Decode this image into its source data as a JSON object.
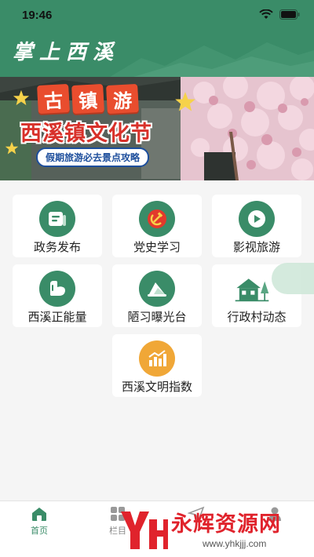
{
  "status": {
    "time": "19:46"
  },
  "header": {
    "title": "掌上西溪"
  },
  "banner": {
    "title_chars": [
      "古",
      "镇",
      "游"
    ],
    "subtitle": "西溪镇文化节",
    "tagline": "假期旅游必去景点攻略"
  },
  "grid": [
    {
      "label": "政务发布",
      "icon": "document-icon",
      "color": "#3a8c68"
    },
    {
      "label": "党史学习",
      "icon": "hammer-sickle-icon",
      "color": "#3a8c68"
    },
    {
      "label": "影视旅游",
      "icon": "play-icon",
      "color": "#3a8c68"
    },
    {
      "label": "西溪正能量",
      "icon": "strength-icon",
      "color": "#3a8c68"
    },
    {
      "label": "陋习曝光台",
      "icon": "megaphone-icon",
      "color": "#3a8c68"
    },
    {
      "label": "行政村动态",
      "icon": "village-icon",
      "color": "#3a8c68"
    },
    {
      "label": "西溪文明指数",
      "icon": "chart-icon",
      "color": "#f0a737"
    }
  ],
  "tabs": [
    {
      "label": "首页",
      "icon": "home-icon",
      "active": true
    },
    {
      "label": "栏目",
      "icon": "grid-icon",
      "active": false
    },
    {
      "label": "",
      "icon": "send-icon",
      "active": false
    },
    {
      "label": "",
      "icon": "user-icon",
      "active": false
    }
  ],
  "watermark": {
    "text": "永辉资源网",
    "url": "www.yhkjjj.com"
  },
  "colors": {
    "primary": "#3a8c68",
    "orange": "#f0a737",
    "banner_red": "#d8312a"
  }
}
